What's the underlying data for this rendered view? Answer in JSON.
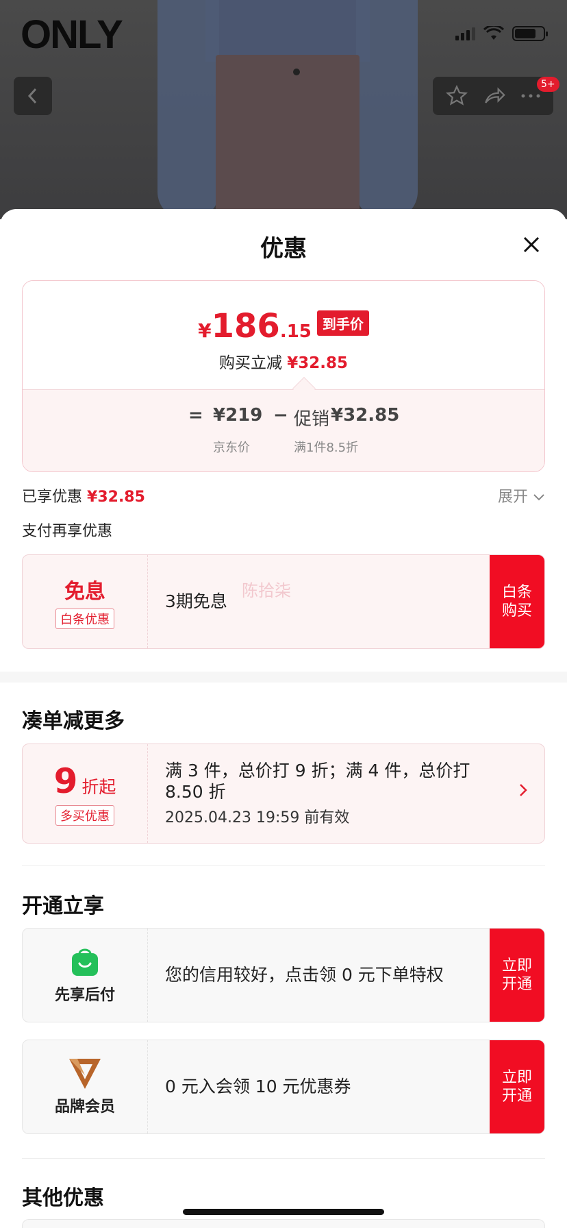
{
  "brand": {
    "logo_text": "ONLY"
  },
  "nav": {
    "badge": "5+"
  },
  "sheet": {
    "title": "优惠"
  },
  "price": {
    "yen": "¥",
    "integer": "186",
    "decimal": ".15",
    "final_tag": "到手价",
    "reduce_label": "购买立减",
    "reduce_value": "¥32.85",
    "formula_eq": "=",
    "jd_price": "¥219",
    "minus": "−",
    "promo_label": "促销",
    "promo_value": "¥32.85",
    "jd_price_label": "京东价",
    "promo_condition": "满1件8.5折"
  },
  "enjoyed": {
    "label": "已享优惠",
    "value": "¥32.85",
    "expand": "展开"
  },
  "pay_more": {
    "label": "支付再享优惠"
  },
  "baitiao": {
    "left_title": "免息",
    "left_badge": "白条优惠",
    "text": "3期免息",
    "watermark": "陈拾柒",
    "cta": "白条购买"
  },
  "bundle": {
    "heading": "凑单减更多",
    "left_number": "9",
    "left_unit": "折起",
    "left_badge": "多买优惠",
    "text": "满 3 件，总价打 9 折；满 4 件，总价打 8.50 折",
    "valid": "2025.04.23 19:59 前有效"
  },
  "open": {
    "heading": "开通立享",
    "items": [
      {
        "left_label": "先享后付",
        "text": "您的信用较好，点击领 0 元下单特权",
        "cta": "立即开通"
      },
      {
        "left_label": "品牌会员",
        "text": "0 元入会领 10 元优惠券",
        "cta": "立即开通"
      }
    ]
  },
  "other": {
    "heading": "其他优惠"
  },
  "colors": {
    "accent": "#e31c2d",
    "cta": "#f10d23",
    "green": "#24c05a",
    "member": "#b8652a"
  }
}
